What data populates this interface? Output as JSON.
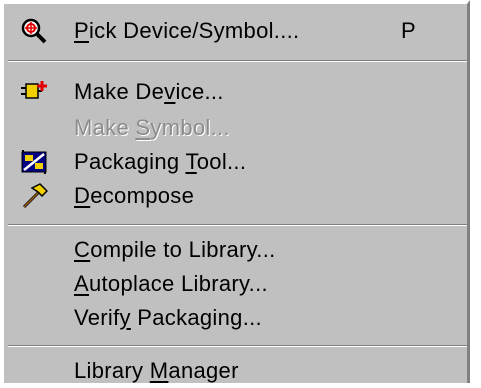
{
  "menu": {
    "items": [
      {
        "pre": "",
        "acc": "P",
        "post": "ick Device/Symbol....",
        "shortcut": "P",
        "icon": "magnifier-icon",
        "enabled": true
      },
      {
        "pre": "Make De",
        "acc": "v",
        "post": "ice...",
        "shortcut": "",
        "icon": "make-device-icon",
        "enabled": true
      },
      {
        "pre": "Make ",
        "acc": "S",
        "post": "ymbol...",
        "shortcut": "",
        "icon": "",
        "enabled": false
      },
      {
        "pre": "Packaging ",
        "acc": "T",
        "post": "ool...",
        "shortcut": "",
        "icon": "packaging-tool-icon",
        "enabled": true
      },
      {
        "pre": "",
        "acc": "D",
        "post": "ecompose",
        "shortcut": "",
        "icon": "hammer-icon",
        "enabled": true
      },
      {
        "pre": "",
        "acc": "C",
        "post": "ompile to Library...",
        "shortcut": "",
        "icon": "",
        "enabled": true
      },
      {
        "pre": "",
        "acc": "A",
        "post": "utoplace Library...",
        "shortcut": "",
        "icon": "",
        "enabled": true
      },
      {
        "pre": "Verif",
        "acc": "y",
        "post": " Packaging...",
        "shortcut": "",
        "icon": "",
        "enabled": true
      },
      {
        "pre": "Library ",
        "acc": "M",
        "post": "anager",
        "shortcut": "",
        "icon": "",
        "enabled": true
      }
    ]
  },
  "colors": {
    "menu_bg": "#c0c0c0",
    "text": "#000000",
    "disabled_text": "#8c8c8c",
    "icon_red": "#e00000",
    "icon_yellow": "#f0d000",
    "icon_blue": "#000080"
  }
}
